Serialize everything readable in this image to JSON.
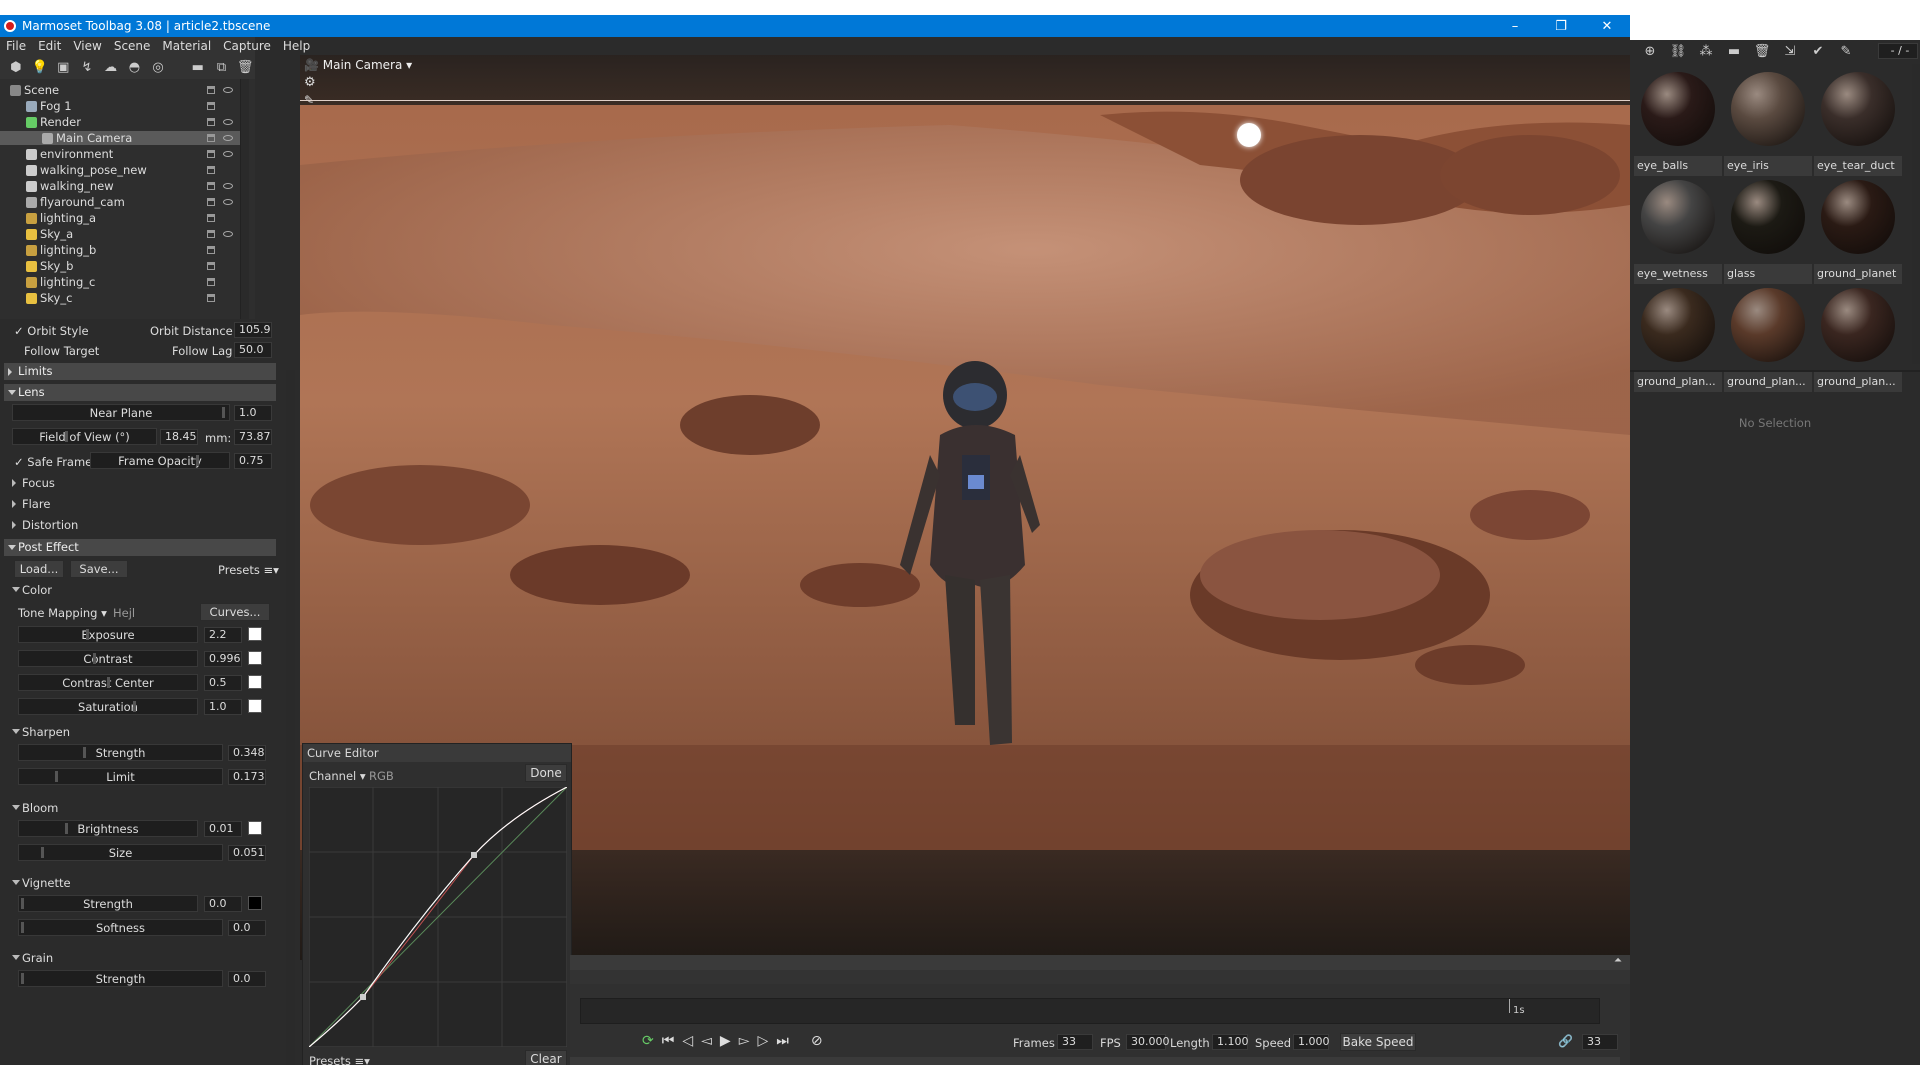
{
  "window": {
    "title": "Marmoset Toolbag 3.08  |  article2.tbscene",
    "min": "–",
    "max": "❐",
    "close": "✕"
  },
  "menu": [
    "File",
    "Edit",
    "View",
    "Scene",
    "Material",
    "Capture",
    "Help"
  ],
  "scene_tree": [
    {
      "label": "Scene",
      "icon": "scene-icon"
    },
    {
      "label": "Fog 1",
      "icon": "fog-icon"
    },
    {
      "label": "Render",
      "icon": "render-icon"
    },
    {
      "label": "Main Camera",
      "icon": "camera-icon",
      "selected": true
    },
    {
      "label": "environment",
      "icon": "object-icon"
    },
    {
      "label": "walking_pose_new",
      "icon": "object-icon"
    },
    {
      "label": "walking_new",
      "icon": "object-icon"
    },
    {
      "label": "flyaround_cam",
      "icon": "camera-icon"
    },
    {
      "label": "lighting_a",
      "icon": "folder-icon"
    },
    {
      "label": "Sky_a",
      "icon": "sky-icon"
    },
    {
      "label": "lighting_b",
      "icon": "folder-icon"
    },
    {
      "label": "Sky_b",
      "icon": "sky-icon"
    },
    {
      "label": "lighting_c",
      "icon": "folder-icon"
    },
    {
      "label": "Sky_c",
      "icon": "sky-icon"
    }
  ],
  "camera": {
    "orbit_style": "Orbit Style",
    "orbit_distance_label": "Orbit Distance:",
    "orbit_distance": "105.9",
    "follow_target": "Follow Target",
    "follow_lag_label": "Follow Lag",
    "follow_lag": "50.0"
  },
  "sections": {
    "limits": "Limits",
    "lens": "Lens",
    "post_effect": "Post Effect"
  },
  "lens": {
    "near_plane_label": "Near Plane",
    "near_plane": "1.0",
    "fov_label": "Field of View (°)",
    "fov": "18.45",
    "mm_label": "mm:",
    "mm": "73.87",
    "safe_frame": "Safe Frame",
    "frame_opacity_label": "Frame Opacity",
    "frame_opacity": "0.75",
    "focus": "Focus",
    "flare": "Flare",
    "distortion": "Distortion"
  },
  "post": {
    "load": "Load...",
    "save": "Save...",
    "presets": "Presets ≡▾",
    "color": "Color",
    "tone_mapping_label": "Tone Mapping ▾",
    "tone_mapping_value": "Hejl",
    "curves": "Curves...",
    "exposure_label": "Exposure",
    "exposure": "2.2",
    "contrast_label": "Contrast",
    "contrast": "0.996",
    "contrast_center_label": "Contrast Center",
    "contrast_center": "0.5",
    "saturation_label": "Saturation",
    "saturation": "1.0",
    "sharpen": "Sharpen",
    "sharpen_strength_label": "Strength",
    "sharpen_strength": "0.348",
    "limit_label": "Limit",
    "limit": "0.173",
    "bloom": "Bloom",
    "brightness_label": "Brightness",
    "brightness": "0.01",
    "size_label": "Size",
    "size": "0.051",
    "vignette": "Vignette",
    "vig_strength_label": "Strength",
    "vig_strength": "0.0",
    "softness_label": "Softness",
    "softness": "0.0",
    "grain": "Grain",
    "grain_strength_label": "Strength",
    "grain_strength": "0.0"
  },
  "viewport": {
    "camera_label": "Main Camera ▾"
  },
  "curve_editor": {
    "title": "Curve Editor",
    "channel_label": "Channel ▾",
    "channel_value": "RGB",
    "done": "Done",
    "presets": "Presets ≡▾",
    "clear": "Clear"
  },
  "timeline": {
    "marker": "1s",
    "frames_label": "Frames",
    "frames": "33",
    "fps_label": "FPS",
    "fps": "30.000",
    "length_label": "Length",
    "length": "1.100",
    "speed_label": "Speed",
    "speed": "1.000",
    "bake_speed": "Bake Speed",
    "frame_current": "33"
  },
  "materials": [
    {
      "name": "eye_balls",
      "color": "#2a1a18"
    },
    {
      "name": "eye_iris",
      "color": "#5a4a40"
    },
    {
      "name": "eye_tear_duct",
      "color": "#3a2e2a"
    },
    {
      "name": "eye_wetness",
      "color": "#444444"
    },
    {
      "name": "glass",
      "color": "#1c1a14"
    },
    {
      "name": "ground_planet",
      "color": "#2a1a14"
    },
    {
      "name": "ground_plan...",
      "color": "#3a2a1e"
    },
    {
      "name": "ground_plan...",
      "color": "#5a3a2a"
    },
    {
      "name": "ground_plan...",
      "color": "#3a2620"
    }
  ],
  "right_toolbar_field": "- / -",
  "no_selection": "No Selection"
}
